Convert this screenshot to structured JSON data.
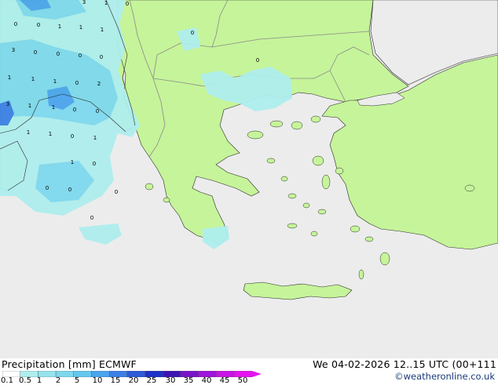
{
  "legend": {
    "title": "Precipitation [mm]  ECMWF",
    "ticks": [
      "0.1",
      "0.5",
      "1",
      "2",
      "5",
      "10",
      "15",
      "20",
      "25",
      "30",
      "35",
      "40",
      "45",
      "50"
    ],
    "colors": [
      "#ffffff",
      "#aeeeee",
      "#96e4ee",
      "#7ed8ee",
      "#64c8ee",
      "#4aa4ee",
      "#3c80e6",
      "#2d5ad8",
      "#1e32c8",
      "#3c14b4",
      "#7814c8",
      "#a014dc",
      "#c814e6",
      "#e614f0"
    ]
  },
  "valid_time": "We 04-02-2026 12..15 UTC (00+111",
  "credit": "©weatheronline.co.uk",
  "map_labels": [
    "3",
    "1",
    "0",
    "0",
    "0",
    "1",
    "1",
    "1",
    "0",
    "3",
    "0",
    "0",
    "0",
    "0",
    "0",
    "1",
    "1",
    "1",
    "0",
    "2",
    "3",
    "1",
    "1",
    "0",
    "0",
    "1",
    "1",
    "0",
    "1",
    "1",
    "0",
    "0",
    "0",
    "0",
    "0"
  ],
  "map_colors": {
    "sea": "#ececec",
    "land": "#c6f49a",
    "border": "#8a8a8a",
    "coast": "#2a2a2a",
    "precip_light": "#aeeeee",
    "precip_mid": "#7ed8ee",
    "precip_heavy": "#3c80e6"
  }
}
